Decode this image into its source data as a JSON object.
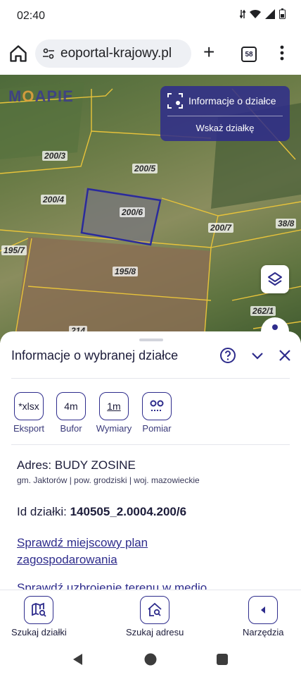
{
  "status": {
    "time": "02:40"
  },
  "browser": {
    "url": "eoportal-krajowy.pl",
    "tab_count": "58"
  },
  "map": {
    "logo_prefix": "M",
    "logo_o": "O",
    "logo_rest": "APIE",
    "parcels": [
      "200/3",
      "200/5",
      "200/4",
      "200/6",
      "200/7",
      "38/8",
      "195/7",
      "195/8",
      "262/1",
      "214"
    ],
    "info_panel": {
      "title": "Informacje o działce",
      "action": "Wskaż działkę"
    }
  },
  "sheet": {
    "title": "Informacje o wybranej działce",
    "tools": [
      {
        "value": "*xlsx",
        "label": "Eksport"
      },
      {
        "value": "4m",
        "label": "Bufor"
      },
      {
        "value": "1m",
        "label": "Wymiary"
      },
      {
        "value": "",
        "label": "Pomiar"
      }
    ],
    "address_label": "Adres: BUDY ZOSINE",
    "address_sub": "gm. Jaktorów | pow. grodziski | woj. mazowieckie",
    "id_label": "Id działki: ",
    "id_value": "140505_2.0004.200/6",
    "link_plan": "Sprawdź miejscowy plan zagospodarowania",
    "link_terrain": "Sprawdź uzbrojenie terenu w medio"
  },
  "bottom_nav": [
    {
      "label": "Szukaj działki"
    },
    {
      "label": "Szukaj adresu"
    },
    {
      "label": "Narzędzia"
    }
  ],
  "colors": {
    "accent": "#2e2c8c",
    "parcel_line": "#e8c33a",
    "selected_parcel": "#2a2a9c"
  }
}
